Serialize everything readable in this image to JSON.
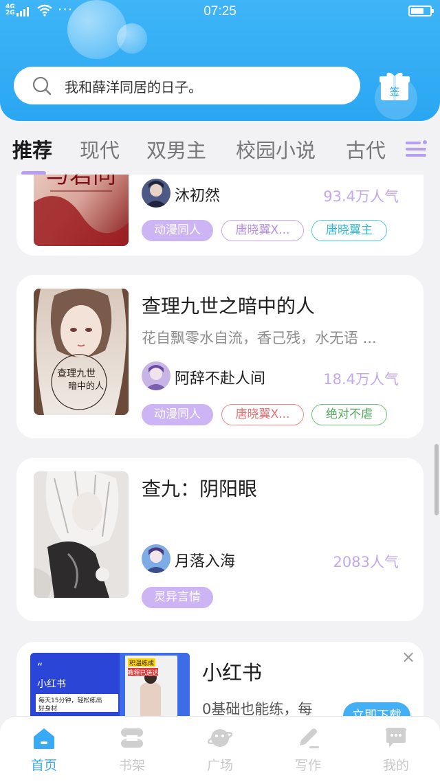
{
  "status_bar": {
    "network": "4G",
    "network2": "2G",
    "more": "···",
    "time": "07:25",
    "battery_level": 0.7
  },
  "search": {
    "placeholder": "我和薛洋同居的日子。"
  },
  "gift": {
    "label": "签",
    "icon": "gift-icon"
  },
  "tabs": [
    {
      "label": "推荐",
      "active": true
    },
    {
      "label": "现代"
    },
    {
      "label": "双男主"
    },
    {
      "label": "校园小说"
    },
    {
      "label": "古代"
    }
  ],
  "books": [
    {
      "cover_text": "与君同",
      "author": "沐初然",
      "popularity": "93.4万人气",
      "tags": [
        {
          "label": "动漫同人",
          "style": "solid"
        },
        {
          "label": "唐晓翼X...",
          "style": "purple"
        },
        {
          "label": "唐晓翼主",
          "style": "cyan"
        }
      ]
    },
    {
      "title": "查理九世之暗中的人",
      "description": "花自飘零水自流，香己残，水无语 ...",
      "cover_text": "查理九世\n暗中的人",
      "author": "阿辞不赴人间",
      "popularity": "18.4万人气",
      "tags": [
        {
          "label": "动漫同人",
          "style": "solid"
        },
        {
          "label": "唐晓翼X...",
          "style": "red"
        },
        {
          "label": "绝对不虐",
          "style": "green"
        }
      ]
    },
    {
      "title": "查九：阴阳眼",
      "author": "月落入海",
      "popularity": "2083人气",
      "tags": [
        {
          "label": "灵异言情",
          "style": "solid"
        }
      ]
    }
  ],
  "ad": {
    "title": "小红书",
    "description": "0基础也能练，每",
    "button": "立即下载",
    "close": "×",
    "image_brand": "小红书",
    "image_caption": "每天15分钟，轻松练出好身材",
    "image_badge": "积温练成",
    "image_badge2": "教程已送达"
  },
  "bottom_nav": [
    {
      "label": "首页",
      "icon": "home-icon",
      "active": true
    },
    {
      "label": "书架",
      "icon": "bookshelf-icon"
    },
    {
      "label": "广场",
      "icon": "planet-icon"
    },
    {
      "label": "写作",
      "icon": "pen-icon"
    },
    {
      "label": "我的",
      "icon": "chat-bubble-icon"
    }
  ],
  "colors": {
    "header_blue": "#3fb5f7",
    "accent_purple": "#b69df5",
    "nav_active": "#3aa9f3"
  }
}
